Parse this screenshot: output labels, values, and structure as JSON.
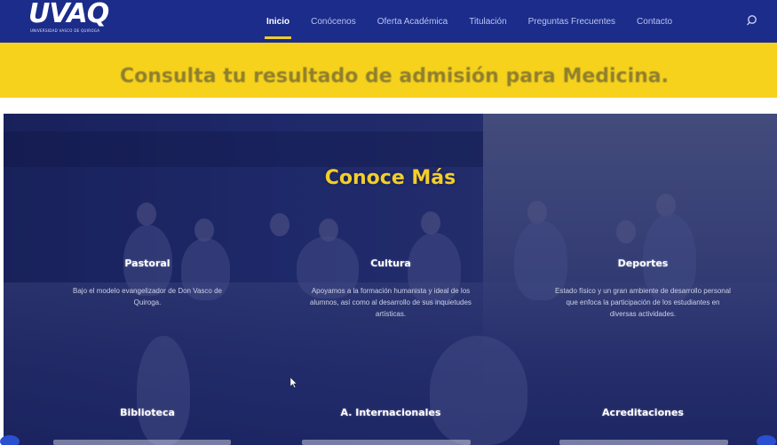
{
  "header": {
    "logo_text": "UVAQ",
    "logo_subtitle": "UNIVERSIDAD VASCO DE QUIROGA",
    "nav_items": [
      {
        "label": "Inicio",
        "active": true
      },
      {
        "label": "Conócenos",
        "active": false
      },
      {
        "label": "Oferta Académica",
        "active": false
      },
      {
        "label": "Titulación",
        "active": false
      },
      {
        "label": "Preguntas Frecuentes",
        "active": false
      },
      {
        "label": "Contacto",
        "active": false
      }
    ],
    "search_icon": "search-icon"
  },
  "banner": {
    "text": "Consulta tu resultado de admisión para Medicina."
  },
  "hero": {
    "title": "Conoce Más",
    "features": [
      {
        "title": "Pastoral",
        "desc": "Bajo el modelo evangelizador de Don Vasco de Quiroga."
      },
      {
        "title": "Cultura",
        "desc": "Apoyamos a la formación humanista y ideal de los alumnos, así como al desarrollo de sus inquietudes artísticas."
      },
      {
        "title": "Deportes",
        "desc": "Estado físico y un gran ambiente de desarrollo personal que enfoca la participación de los estudiantes en diversas actividades."
      },
      {
        "title": "Biblioteca",
        "desc": ""
      },
      {
        "title": "A. Internacionales",
        "desc": ""
      },
      {
        "title": "Acreditaciones",
        "desc": ""
      }
    ]
  },
  "colors": {
    "header_bg": "#1b2c8a",
    "banner_bg": "#f6d21d",
    "accent_yellow": "#f3ce2a",
    "hero_overlay": "#222b6a"
  }
}
